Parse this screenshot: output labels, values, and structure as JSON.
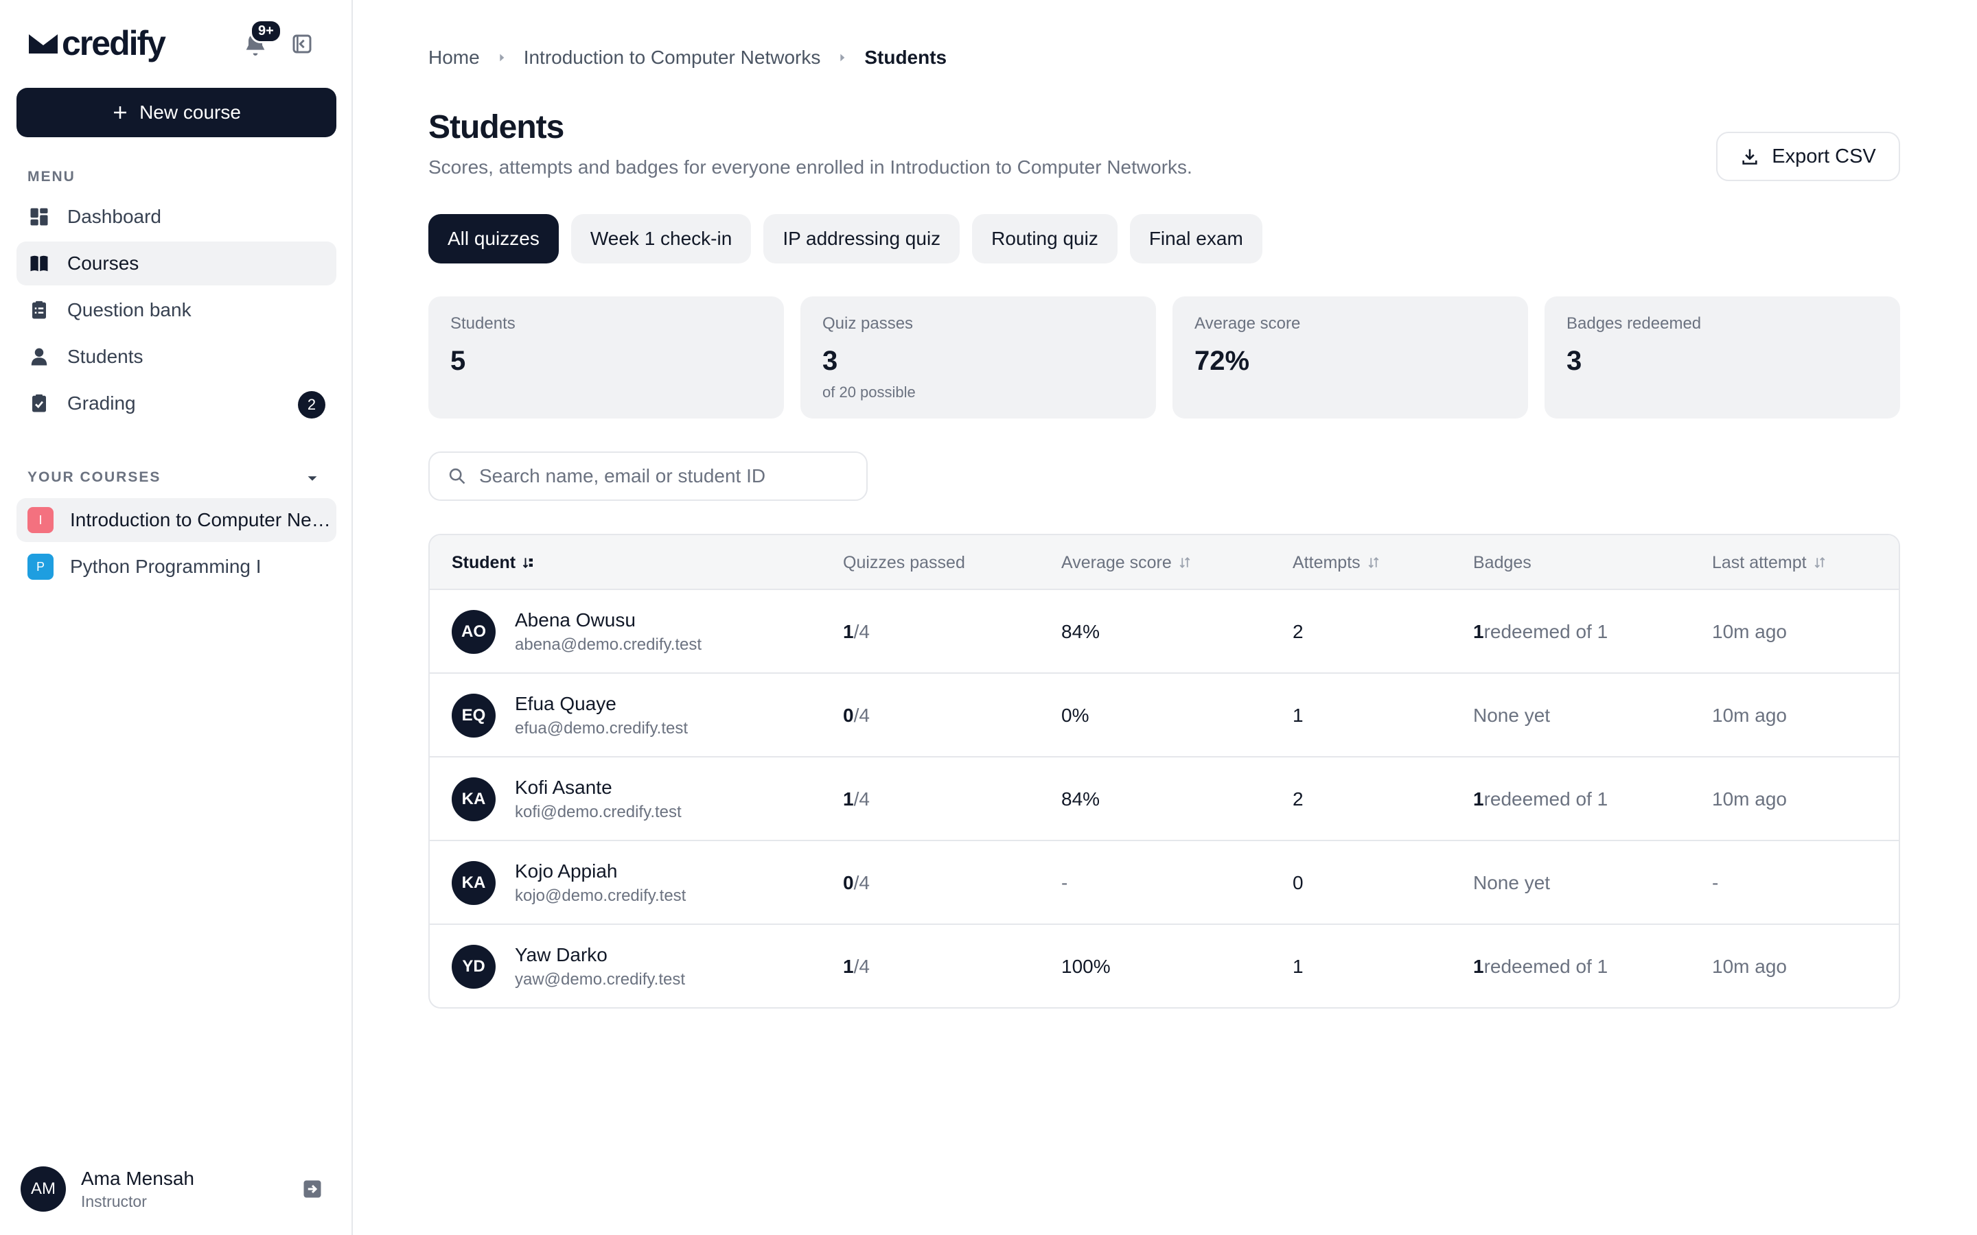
{
  "sidebar": {
    "logo_text": "credify",
    "notifications": "9+",
    "new_course_label": "New course",
    "menu_label": "MENU",
    "nav": [
      {
        "label": "Dashboard",
        "icon": "dashboard-icon"
      },
      {
        "label": "Courses",
        "icon": "book-icon",
        "active": true
      },
      {
        "label": "Question bank",
        "icon": "clipboard-list-icon"
      },
      {
        "label": "Students",
        "icon": "user-icon"
      },
      {
        "label": "Grading",
        "icon": "clipboard-check-icon",
        "badge": "2"
      }
    ],
    "courses_label": "YOUR COURSES",
    "courses": [
      {
        "initial": "I",
        "name": "Introduction to Computer Networks",
        "color": "#f4717f",
        "active": true
      },
      {
        "initial": "P",
        "name": "Python Programming I",
        "color": "#1e9ee0"
      }
    ],
    "user": {
      "initials": "AM",
      "name": "Ama Mensah",
      "role": "Instructor"
    }
  },
  "breadcrumb": [
    "Home",
    "Introduction to Computer Networks",
    "Students"
  ],
  "page": {
    "title": "Students",
    "subtitle": "Scores, attempts and badges for everyone enrolled in Introduction to Computer Networks.",
    "export_label": "Export CSV"
  },
  "tabs": [
    "All quizzes",
    "Week 1 check-in",
    "IP addressing quiz",
    "Routing quiz",
    "Final exam"
  ],
  "stats": [
    {
      "label": "Students",
      "value": "5",
      "sub": ""
    },
    {
      "label": "Quiz passes",
      "value": "3",
      "sub": "of 20 possible"
    },
    {
      "label": "Average score",
      "value": "72%",
      "sub": ""
    },
    {
      "label": "Badges redeemed",
      "value": "3",
      "sub": ""
    }
  ],
  "search": {
    "placeholder": "Search name, email or student ID"
  },
  "table": {
    "columns": [
      "Student",
      "Quizzes passed",
      "Average score",
      "Attempts",
      "Badges",
      "Last attempt"
    ],
    "rows": [
      {
        "initials": "AO",
        "name": "Abena Owusu",
        "email": "abena@demo.credify.test",
        "passed": "1",
        "total": "/4",
        "avg": "84%",
        "attempts": "2",
        "badge_count": "1",
        "badge_text": " redeemed of 1",
        "last": "10m ago"
      },
      {
        "initials": "EQ",
        "name": "Efua Quaye",
        "email": "efua@demo.credify.test",
        "passed": "0",
        "total": "/4",
        "avg": "0%",
        "attempts": "1",
        "badge_count": "",
        "badge_text": "None yet",
        "last": "10m ago"
      },
      {
        "initials": "KA",
        "name": "Kofi Asante",
        "email": "kofi@demo.credify.test",
        "passed": "1",
        "total": "/4",
        "avg": "84%",
        "attempts": "2",
        "badge_count": "1",
        "badge_text": " redeemed of 1",
        "last": "10m ago"
      },
      {
        "initials": "KA",
        "name": "Kojo Appiah",
        "email": "kojo@demo.credify.test",
        "passed": "0",
        "total": "/4",
        "avg": "-",
        "attempts": "0",
        "badge_count": "",
        "badge_text": "None yet",
        "last": "-"
      },
      {
        "initials": "YD",
        "name": "Yaw Darko",
        "email": "yaw@demo.credify.test",
        "passed": "1",
        "total": "/4",
        "avg": "100%",
        "attempts": "1",
        "badge_count": "1",
        "badge_text": " redeemed of 1",
        "last": "10m ago"
      }
    ]
  },
  "colors": {
    "primary": "#0f172a",
    "surface": "#f1f2f4",
    "border": "#e5e7eb",
    "muted": "#6b7280"
  }
}
